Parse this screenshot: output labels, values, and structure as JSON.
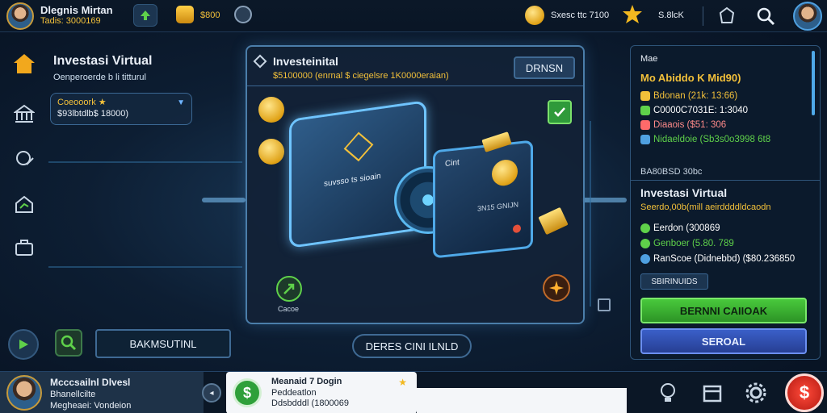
{
  "topbar": {
    "user_name": "Dlegnis Mirtan",
    "user_sub": "Tadis: 3000169",
    "coin_balance": "$800",
    "mid_text": "Sxesc ttc 7100",
    "right_text": "S.8lcK",
    "icons": [
      "arrow-up-icon",
      "coin-icon",
      "gear-icon",
      "smile-coin-icon",
      "star-coin-icon",
      "achievement-icon",
      "search-icon"
    ]
  },
  "left_panel": {
    "title": "Investasi Virtual",
    "subtitle": "Oenperoerde b li titturul",
    "box_line1": "Coeooork ★",
    "box_line2": "$93lbtdlb$ 18000)",
    "bottom_button": "BAKMSUTINL",
    "side_icons": [
      "home-icon",
      "bank-icon",
      "edit-icon",
      "chart-icon",
      "briefcase-icon"
    ]
  },
  "main_card": {
    "title": "Investeinital",
    "subtitle": "$5100000 (enrnal $ ciegelsre 1K0000eraian)",
    "header_button": "DRNSN",
    "card_left_text": "suvsso ts sioain",
    "card_right_label": "Cint",
    "card_right_value": "3N15 GNIJN",
    "bottom_left_label": "Cacoe"
  },
  "center_pill": "DERES CINI ILNLD",
  "right_panel": {
    "top_label": "Mae",
    "top_value": "Mo Abiddo K Mid90)",
    "stats": [
      {
        "text": "Bdonan (21k: 13:66)",
        "color": "#f2c03a"
      },
      {
        "text": "C0000C7031E: 1:3040",
        "color": "#ffffff"
      },
      {
        "text": "Diaaois ($51: 306",
        "color": "#ff6a6a"
      },
      {
        "text": "Nidaeldoie (Sb3s0o3998 6t8",
        "color": "#5fd14a"
      }
    ],
    "divider_label": "BA80BSD 30bc",
    "section_title": "Investasi Virtual",
    "section_sub": "Seerdo,00b(mill aeirddddldcaodn",
    "section_stats": [
      {
        "text": "Eerdon (300869",
        "color": "#ffffff"
      },
      {
        "text": "Genboer (5.80. 789",
        "color": "#5fd14a"
      },
      {
        "text": "RanScoe (Didnebbd) ($80.236850",
        "color": "#ffffff"
      }
    ],
    "tag": "SBIRINUIDS",
    "btn_green": "BERNNI CAIIOAK",
    "btn_blue": "SEROAL"
  },
  "bottom": {
    "user_name": "Mcccsailnl Dlvesl",
    "user_line2": "Bhanellcilte",
    "user_line3": "Megheaei: Vondeion",
    "notif_title": "Meanaid 7 Dogin",
    "notif_line2": "Peddeatlon",
    "notif_line3": "Ddsbdddl (1800069",
    "icons": [
      "cash-icon",
      "bulb-icon",
      "store-icon",
      "settings-icon",
      "logo-icon"
    ]
  },
  "colors": {
    "accent_gold": "#f2c03a",
    "accent_green": "#4fc33f",
    "accent_blue": "#3a5fc8",
    "panel_border": "#3b6894"
  }
}
